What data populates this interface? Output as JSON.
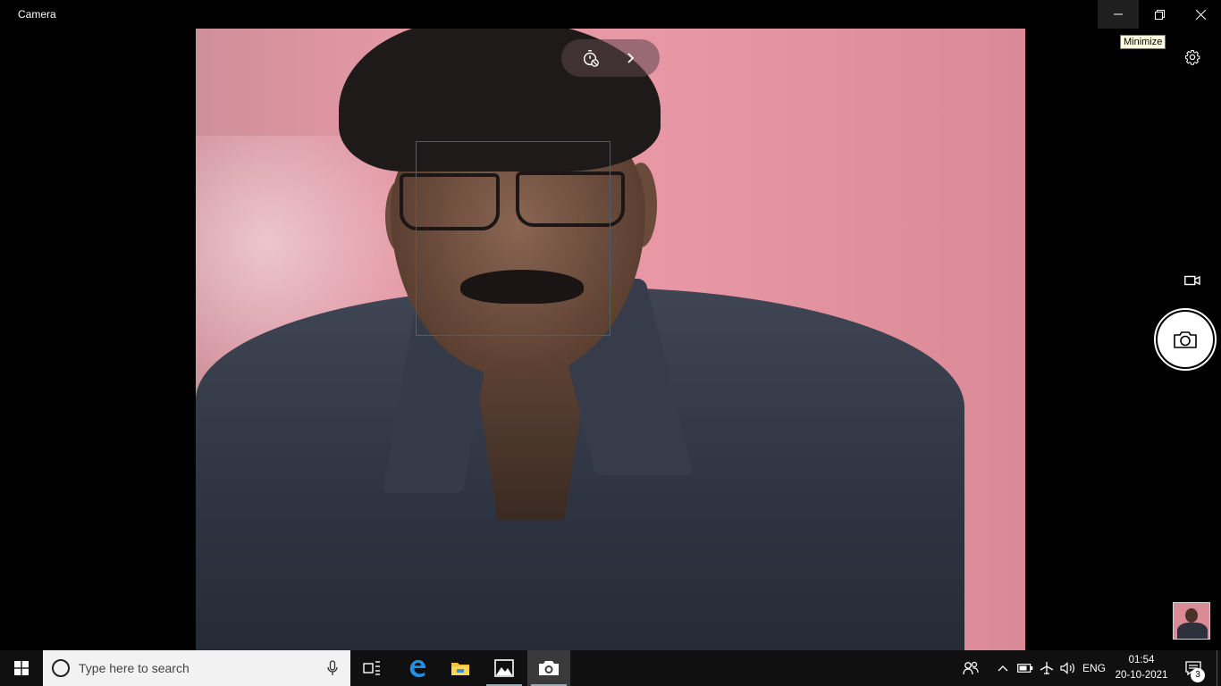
{
  "window": {
    "title": "Camera",
    "tooltip": "Minimize",
    "controls": [
      "minimize-icon",
      "restore-icon",
      "close-icon"
    ]
  },
  "toolbar": {
    "timer_icon": "self-timer-off-icon",
    "more_icon": "chevron-right-icon",
    "settings_icon": "gear-icon"
  },
  "capture": {
    "video_mode_icon": "video-camera-icon",
    "shutter_icon": "photo-camera-icon"
  },
  "taskbar": {
    "search_placeholder": "Type here to search",
    "pinned_apps": [
      "task-view-icon",
      "edge-icon",
      "file-explorer-icon",
      "photos-icon",
      "camera-icon"
    ],
    "language": "ENG",
    "time": "01:54",
    "date": "20-10-2021",
    "notification_count": "3"
  },
  "colors": {
    "background": "#000000",
    "taskbar": "#101010",
    "search_box": "#f2f2f2",
    "tooltip_bg": "#ffffe1"
  }
}
